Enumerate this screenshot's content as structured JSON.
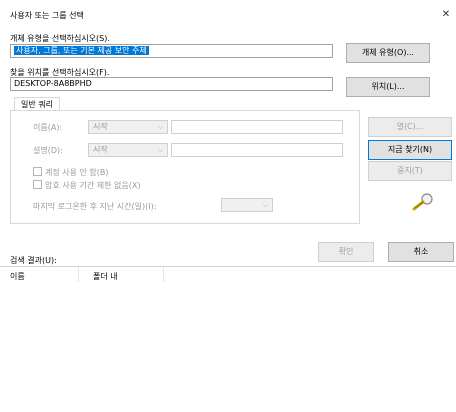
{
  "window": {
    "title": "사용자 또는 그룹 선택",
    "close_glyph": "✕"
  },
  "object_type": {
    "label": "개체 유형을 선택하십시오(S).",
    "value": "사용자, 그룹, 또는 기본 제공 보안 주체",
    "button": "개체 유형(O)..."
  },
  "location": {
    "label": "찾을 위치를 선택하십시오(F).",
    "value": "DESKTOP-8A8BPHD",
    "button": "위치(L)..."
  },
  "tab": {
    "label": "일반 쿼리"
  },
  "query": {
    "name_label": "이름(A):",
    "name_combo": "시작",
    "desc_label": "설명(D):",
    "desc_combo": "시작",
    "disabled_accounts": "계정 사용 안 함(B)",
    "non_expiring": "암호 사용 기간 제한 없음(X)",
    "days_label": "마지막 로그온한 후 지난 시간(일)(I):",
    "days_combo": ""
  },
  "side_buttons": {
    "columns": "열(C)...",
    "find_now": "지금 찾기(N)",
    "stop": "중지(T)"
  },
  "footer": {
    "ok": "확인",
    "cancel": "취소"
  },
  "results": {
    "label": "검색 결과(U):",
    "columns": [
      "이름",
      "폴더 내"
    ]
  }
}
